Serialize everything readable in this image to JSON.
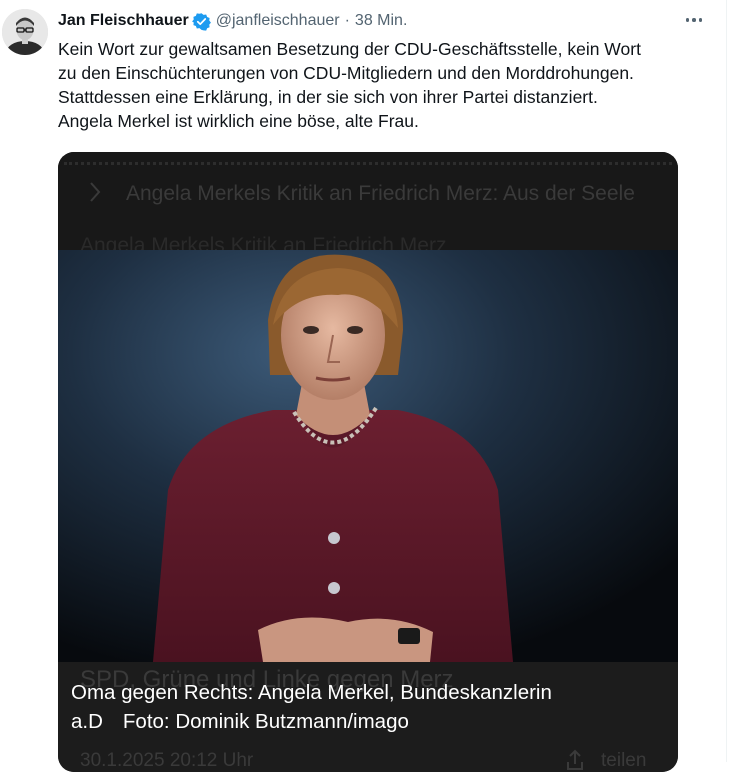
{
  "tweet": {
    "author_name": "Jan Fleischhauer",
    "handle": "@janfleischhauer",
    "separator": "·",
    "time": "38 Min.",
    "verified_color": "#1d9bf0",
    "more_icon": "ellipsis-icon",
    "text_lines": [
      "Kein Wort zur gewaltsamen Besetzung der CDU-Geschäftsstelle, kein Wort",
      "zu den Einschüchterungen von CDU-Mitgliedern und den Morddrohungen.",
      "Stattdessen eine Erklärung, in der sie sich von ihrer Partei distanziert.",
      "Angela Merkel ist wirklich eine böse, alte Frau."
    ]
  },
  "media": {
    "ghost_headline": "Angela Merkels Kritik an Friedrich Merz: Aus der Seele",
    "ghost_line2": "Angela Merkels Kritik an Friedrich Merz",
    "caption_ghost": "SPD, Grüne und Linke gegen Merz",
    "caption_line1": "Oma gegen Rechts: Angela Merkel, Bundeskanzlerin",
    "caption_line2_prefix": "a.D",
    "caption_credit": "Foto: Dominik Butzmann/imago",
    "footer_date": "30.1.2025",
    "footer_time": "20:12 Uhr",
    "share_label": "teilen",
    "share_icon": "share-icon",
    "chevron_icon": "chevron-right-icon"
  }
}
